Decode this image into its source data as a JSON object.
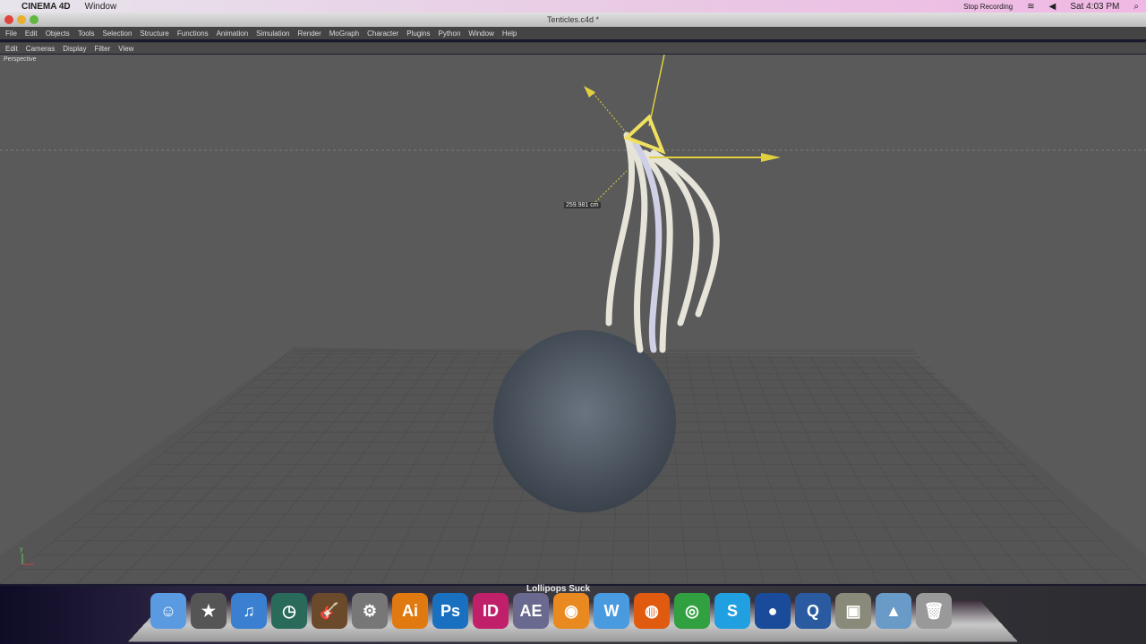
{
  "macbar": {
    "app": "CINEMA 4D",
    "menu": "Window",
    "recording": "Stop Recording",
    "clock": "Sat 4:03 PM"
  },
  "window": {
    "title": "Tenticles.c4d *"
  },
  "menu": [
    "File",
    "Edit",
    "Objects",
    "Tools",
    "Selection",
    "Structure",
    "Functions",
    "Animation",
    "Simulation",
    "Render",
    "MoGraph",
    "Character",
    "Plugins",
    "Python",
    "Window",
    "Help"
  ],
  "viewmenu": [
    "Edit",
    "Cameras",
    "Display",
    "Filter",
    "View"
  ],
  "viewport": {
    "label": "Perspective",
    "measure": "259.981 cm"
  },
  "dock": {
    "label": "Lollipops Suck",
    "icons": [
      {
        "name": "finder",
        "text": "☺",
        "color": "#5a9ae0"
      },
      {
        "name": "imovie",
        "text": "★",
        "color": "#555"
      },
      {
        "name": "itunes",
        "text": "♫",
        "color": "#3a7fd0"
      },
      {
        "name": "time-machine",
        "text": "◷",
        "color": "#2a6a5a"
      },
      {
        "name": "garageband",
        "text": "🎸",
        "color": "#6a4a2a"
      },
      {
        "name": "system-preferences",
        "text": "⚙",
        "color": "#777"
      },
      {
        "name": "illustrator",
        "text": "Ai",
        "color": "#e07a10"
      },
      {
        "name": "photoshop",
        "text": "Ps",
        "color": "#1a70c0"
      },
      {
        "name": "indesign",
        "text": "ID",
        "color": "#c0206a"
      },
      {
        "name": "after-effects",
        "text": "AE",
        "color": "#6a6a90"
      },
      {
        "name": "blender",
        "text": "◉",
        "color": "#e88a20"
      },
      {
        "name": "word",
        "text": "W",
        "color": "#4a9ae0"
      },
      {
        "name": "firefox",
        "text": "◍",
        "color": "#e05a10"
      },
      {
        "name": "chrome",
        "text": "◎",
        "color": "#30a040"
      },
      {
        "name": "skype",
        "text": "S",
        "color": "#20a0e0"
      },
      {
        "name": "globe",
        "text": "●",
        "color": "#1a4a9a"
      },
      {
        "name": "quicktime",
        "text": "Q",
        "color": "#2a5aa0"
      },
      {
        "name": "preview",
        "text": "▣",
        "color": "#8a8a7a"
      },
      {
        "name": "applications-folder",
        "text": "▲",
        "color": "#6a9ac8"
      },
      {
        "name": "trash",
        "text": "🗑",
        "color": "#999"
      }
    ]
  }
}
